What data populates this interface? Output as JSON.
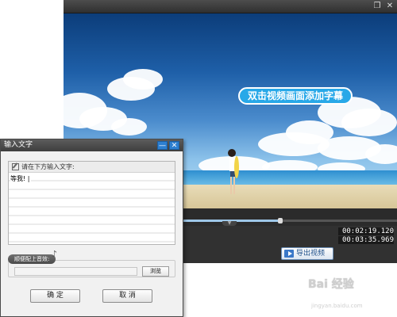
{
  "window": {
    "restore_icon": "restore-icon",
    "close_icon": "close-icon"
  },
  "video": {
    "caption": "双击视频画面添加字幕"
  },
  "timeline": {
    "progress": 0.65,
    "current_time": "00:02:19.120",
    "total_time": "00:03:35.969"
  },
  "toolbar": {
    "export_label": "导出视频"
  },
  "dialog": {
    "title": "输入文字",
    "minimize_icon": "minimize-icon",
    "close_icon": "close-icon",
    "prompt": "请在下方输入文字:",
    "text_value": "等我! |",
    "sound_label": "顺便配上音效:",
    "sound_file": "",
    "browse_label": "浏览",
    "ok_label": "确 定",
    "cancel_label": "取 消"
  },
  "watermark": {
    "brand": "Bai 经验",
    "url": "jingyan.baidu.com"
  },
  "colors": {
    "caption_bg": "#28a8e8",
    "dialog_button": "#2d7fd0",
    "export_text": "#1d4f8a"
  }
}
